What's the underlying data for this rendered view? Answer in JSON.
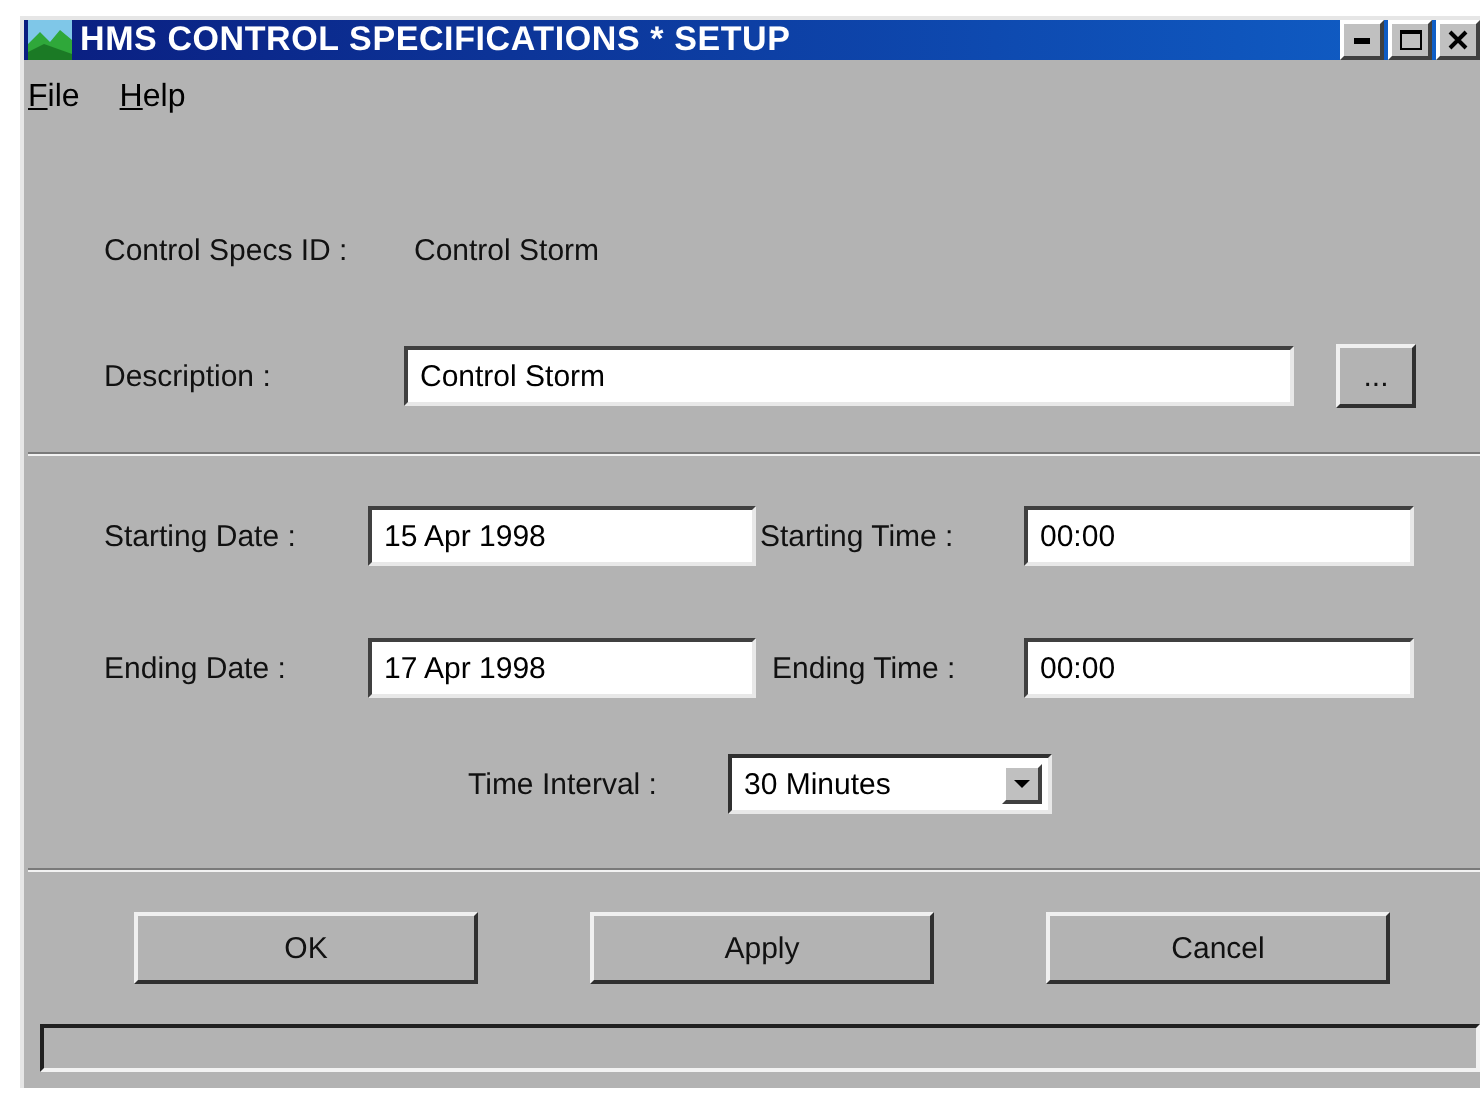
{
  "window": {
    "title": "HMS CONTROL SPECIFICATIONS * SETUP"
  },
  "menu": [
    "File",
    "Help"
  ],
  "specs_id": {
    "label": "Control Specs ID :",
    "value": "Control Storm"
  },
  "description": {
    "label": "Description :",
    "value": "Control Storm",
    "browse": "..."
  },
  "start": {
    "date_label": "Starting Date :",
    "date": "15 Apr 1998",
    "time_label": "Starting Time :",
    "time": "00:00"
  },
  "end": {
    "date_label": "Ending Date :",
    "date": "17 Apr 1998",
    "time_label": "Ending Time :",
    "time": "00:00"
  },
  "interval": {
    "label": "Time Interval :",
    "value": "30 Minutes"
  },
  "buttons": [
    "OK",
    "Apply",
    "Cancel"
  ]
}
